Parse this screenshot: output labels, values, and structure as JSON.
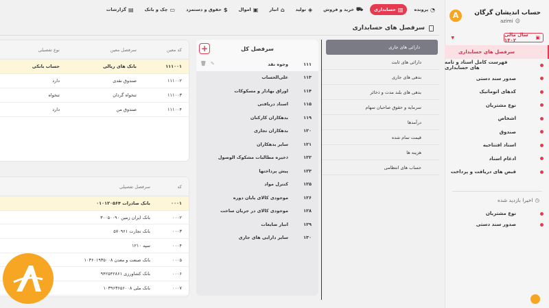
{
  "sidebar": {
    "brand": "حساب اندیشان گرگان",
    "user": "azimi",
    "year": "سال مالی ۱۴۰۲",
    "items": [
      {
        "label": "سرفصل های حسابداری",
        "active": true
      },
      {
        "label": "فهرست کامل اسناد و تامه های حسابداری"
      },
      {
        "label": "صدور سند دستی"
      },
      {
        "label": "کدهای اتوماتیک"
      },
      {
        "label": "نوع مشتریان"
      },
      {
        "label": "اشخاص"
      },
      {
        "label": "صندوق"
      },
      {
        "label": "اسناد افتتاحیه"
      },
      {
        "label": "ادغام اسناد"
      },
      {
        "label": "قبض های دریافت و پرداخت"
      }
    ],
    "recent_title": "اخیرا بازدید شده",
    "recent": [
      {
        "label": "نوع مشتریان"
      },
      {
        "label": "صدور سند دستی"
      }
    ]
  },
  "topnav": [
    {
      "label": "پرونده",
      "icon": "gauge-icon"
    },
    {
      "label": "حسابداری",
      "icon": "chart-icon",
      "active": true
    },
    {
      "label": "خرید و فروش",
      "icon": "cart-icon"
    },
    {
      "label": "تولید",
      "icon": "cube-icon"
    },
    {
      "label": "انبار",
      "icon": "warehouse-icon"
    },
    {
      "label": "اموال",
      "icon": "box-icon"
    },
    {
      "label": "حقوق و دستمزد",
      "icon": "dollar-icon"
    },
    {
      "label": "چک و بانک",
      "icon": "card-icon"
    },
    {
      "label": "گزارشات",
      "icon": "report-icon"
    }
  ],
  "page_title": "سرفصل های حسابداری",
  "categories": [
    {
      "label": "دارائی های جاری",
      "active": true
    },
    {
      "label": "دارائی های ثابت"
    },
    {
      "label": "بدهی های جاری"
    },
    {
      "label": "بدهی های بلند مدت و ذخائر"
    },
    {
      "label": "سرمایه و حقوق صاحبان سهام"
    },
    {
      "label": "درآمدها"
    },
    {
      "label": "قیمت تمام شده"
    },
    {
      "label": "هزینه ها"
    },
    {
      "label": "حساب های انتظامی"
    }
  ],
  "kol": {
    "title": "سرفصل کل",
    "rows": [
      {
        "code": "۱۱۱",
        "label": "وجوه نقد",
        "active": true
      },
      {
        "code": "۱۱۳",
        "label": "علی‌الحساب"
      },
      {
        "code": "۱۱۴",
        "label": "اوراق بهادار و مسکوکات"
      },
      {
        "code": "۱۱۵",
        "label": "اسناد دریافتی"
      },
      {
        "code": "۱۱۹",
        "label": "بدهکاران کارکنان"
      },
      {
        "code": "۱۲۰",
        "label": "بدهکاران تجاری"
      },
      {
        "code": "۱۲۱",
        "label": "سایر بدهکاران"
      },
      {
        "code": "۱۲۲",
        "label": "ذخیره مطالبات مشکوک الوصول"
      },
      {
        "code": "۱۲۳",
        "label": "پیش پرداختها"
      },
      {
        "code": "۱۲۵",
        "label": "کنترل مواد"
      },
      {
        "code": "۱۲۶",
        "label": "موجودی کالای پایان دوره"
      },
      {
        "code": "۱۲۸",
        "label": "موجودی کالای در جریان ساخت"
      },
      {
        "code": "۱۲۹",
        "label": "انبار ضایعات"
      },
      {
        "code": "۱۳۰",
        "label": "سایر دارایی های جاری"
      }
    ]
  },
  "moein": {
    "headers": [
      "نوع تفصیلی",
      "سرفصل معین",
      "کد معین"
    ],
    "rows": [
      {
        "type": "حساب بانکی",
        "name": "بانک های ریالی",
        "code": "۱۱۱۰۰۱",
        "hl": true
      },
      {
        "type": "دارد",
        "name": "صندوق نقدی",
        "code": "۱۱۱۰۰۲"
      },
      {
        "type": "تنخواه",
        "name": "تنخواه گردان",
        "code": "۱۱۱۰۰۳"
      },
      {
        "type": "دارد",
        "name": "صندوق من",
        "code": "۱۱۱۰۰۴"
      }
    ]
  },
  "tafsili": {
    "headers": [
      "سرفصل تفصیلی",
      "کد"
    ],
    "rows": [
      {
        "name": "بانک صادرات ۰۱۰۱۲۰۵۶۴",
        "code": "۰۰۰۱",
        "hl": true
      },
      {
        "name": "بانک ایران زمین ۳۰۰۵۰۰۹۰",
        "code": "۰۰۰۲"
      },
      {
        "name": "بانک تجارت ۵۷۰۹۶۱",
        "code": "۰۰۰۳"
      },
      {
        "name": "سپه ۱۲۱۰",
        "code": "۰۰۰۴"
      },
      {
        "name": "بانک صنعت و معدن ۱۰۳۶۰۱۹۳۵۰۰۸",
        "code": "۰۰۰۵"
      },
      {
        "name": "بانک کشاورزی ۹۴۲۵۴۲۸۶۱",
        "code": "۰۰۰۶"
      },
      {
        "name": "بانک ملی ۱۰۳۹۶۳۶۵۶۰۰۸",
        "code": "۰۰۰۷"
      }
    ]
  }
}
